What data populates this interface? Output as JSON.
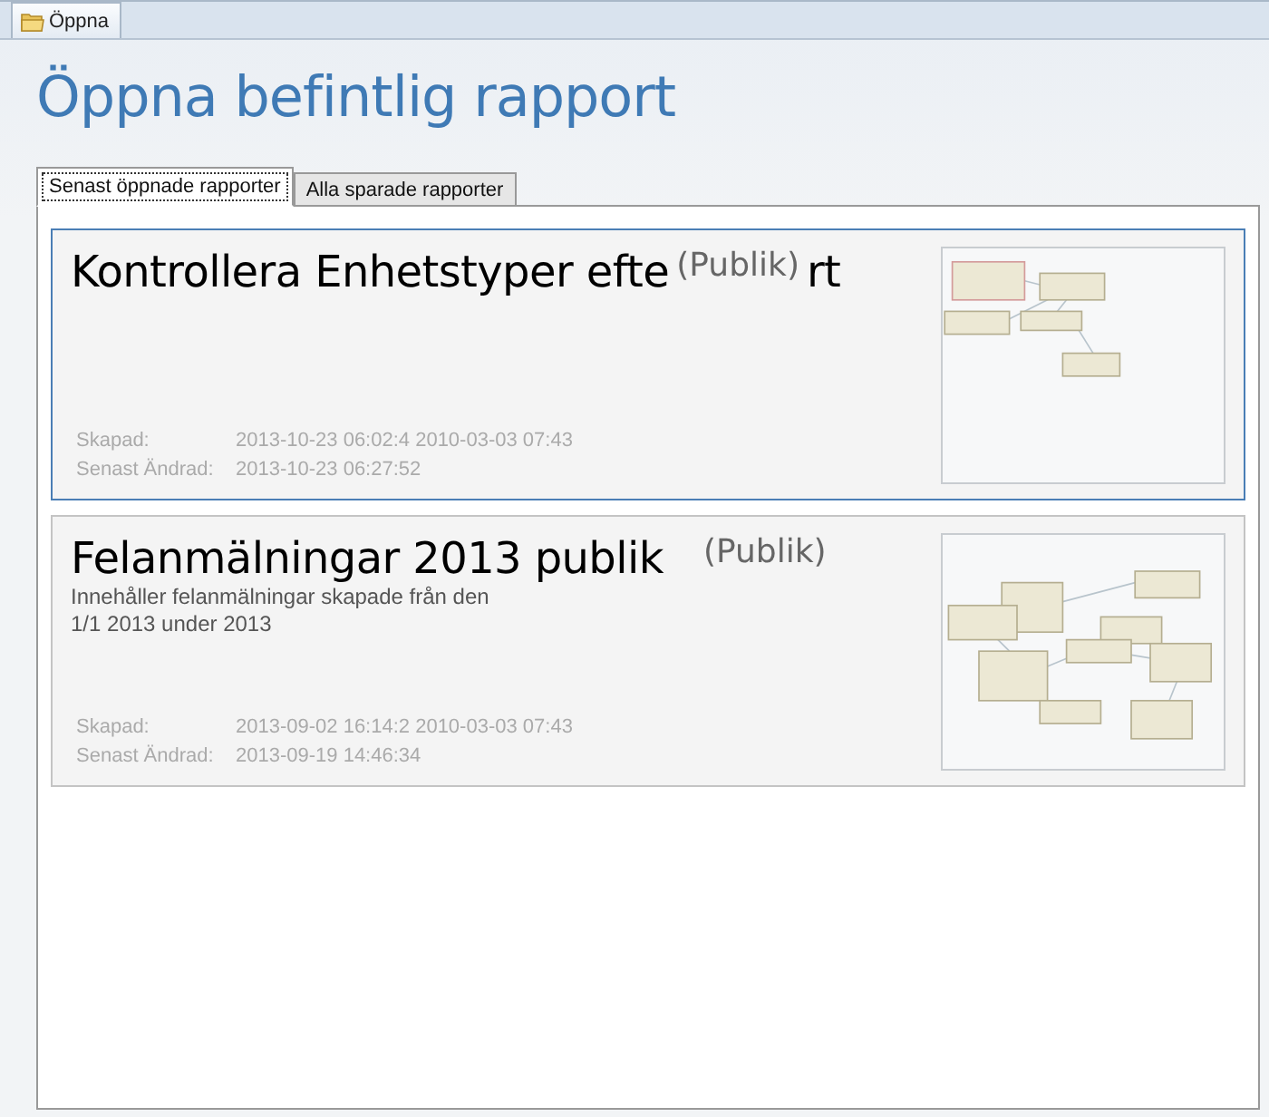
{
  "window_tab": {
    "label": "Öppna"
  },
  "heading": "Öppna befintlig rapport",
  "tabs": [
    {
      "label": "Senast öppnade rapporter",
      "selected": true
    },
    {
      "label": "Alla sparade rapporter",
      "selected": false
    }
  ],
  "reports": [
    {
      "title": "Kontrollera Enhetstyper efte",
      "title_tail": "rt",
      "visibility": "(Publik)",
      "selected": true,
      "created_label": "Skapad:",
      "created": "2013-10-23 06:02:4 2010-03-03 07:43",
      "modified_label": "Senast Ändrad:",
      "modified": "2013-10-23 06:27:52"
    },
    {
      "title": "Felanmälningar 2013 publik",
      "visibility": "(Publik)",
      "selected": false,
      "description": [
        "Innehåller felanmälningar skapade från den",
        "1/1 2013 under 2013"
      ],
      "created_label": "Skapad:",
      "created": "2013-09-02 16:14:2 2010-03-03 07:43",
      "modified_label": "Senast Ändrad:",
      "modified": "2013-09-19 14:46:34"
    }
  ]
}
